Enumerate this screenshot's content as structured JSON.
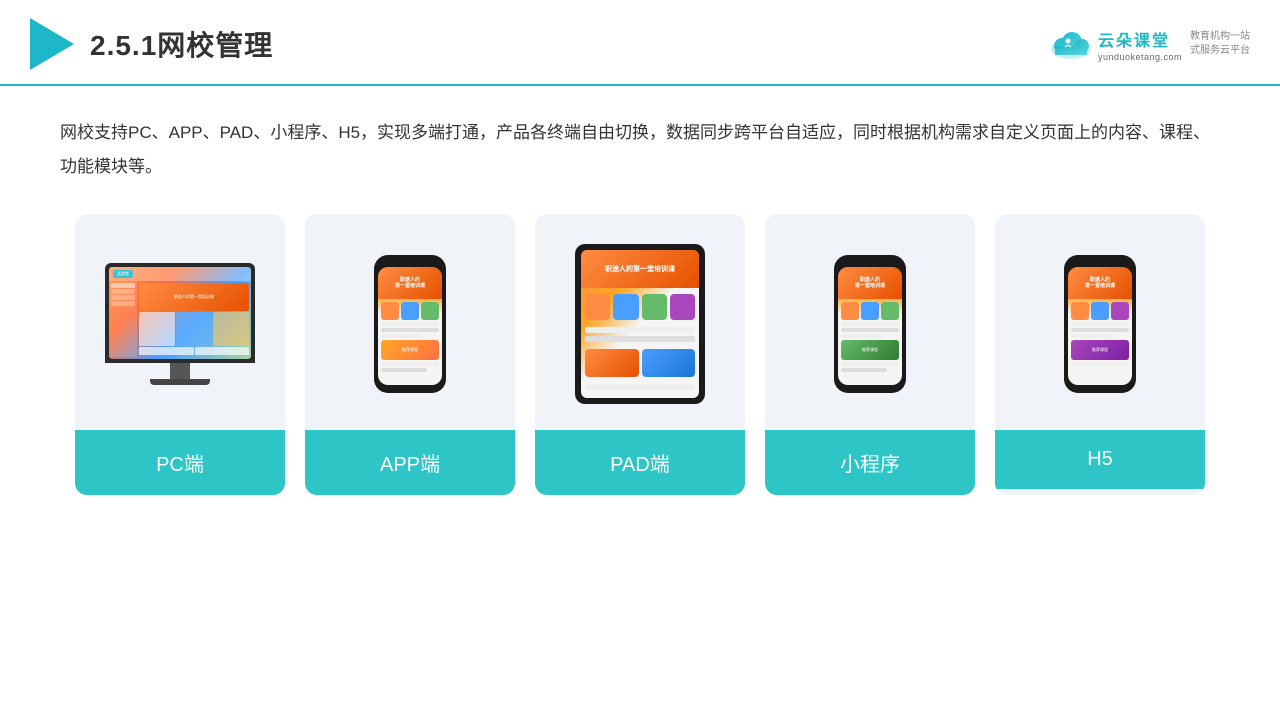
{
  "header": {
    "title": "2.5.1网校管理",
    "brand_main": "云朵课堂",
    "brand_url": "yunduoketang.com",
    "brand_slogan_line1": "教育机构一站",
    "brand_slogan_line2": "式服务云平台"
  },
  "description": "网校支持PC、APP、PAD、小程序、H5，实现多端打通，产品各终端自由切换，数据同步跨平台自适应，同时根据机构需求自定义页面上的内容、课程、功能模块等。",
  "cards": [
    {
      "id": "pc",
      "label": "PC端"
    },
    {
      "id": "app",
      "label": "APP端"
    },
    {
      "id": "pad",
      "label": "PAD端"
    },
    {
      "id": "miniapp",
      "label": "小程序"
    },
    {
      "id": "h5",
      "label": "H5"
    }
  ],
  "colors": {
    "teal": "#2dc5c5",
    "dark_teal": "#1cb8c8",
    "orange": "#ff8c42"
  }
}
